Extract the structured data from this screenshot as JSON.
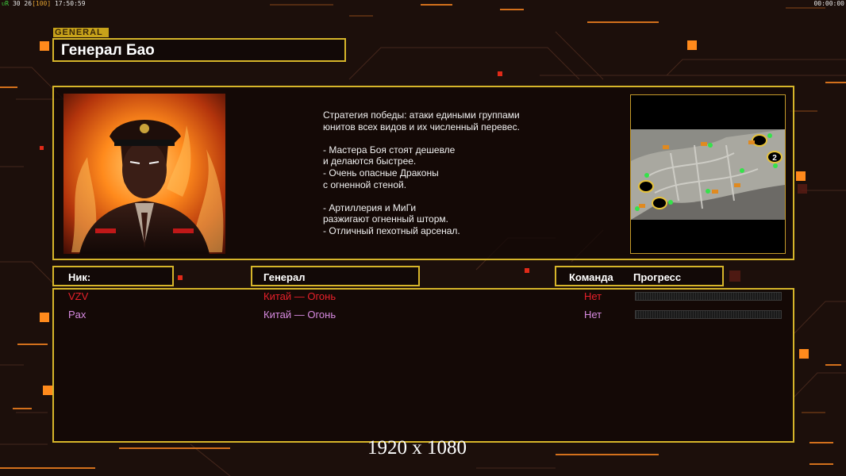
{
  "hud": {
    "top_left_prefix": "ᴜR",
    "top_left_fps": "30",
    "top_left_frame": "26",
    "top_left_bracket": "[100]",
    "top_left_time": "17:50:59",
    "top_right_time": "00:00:00"
  },
  "section_label": "GENERAL",
  "general_title": "Генерал Бао",
  "description": {
    "lines": [
      "Стратегия победы: атаки едиными группами",
      "юнитов всех видов и их численный перевес.",
      "",
      "- Мастера Боя стоят дешевле",
      "и делаются быстрее.",
      "- Очень опасные Драконы",
      "с огненной стеной.",
      "",
      "- Артиллерия и МиГи",
      "разжигают огненный шторм.",
      "- Отличный пехотный арсенал."
    ]
  },
  "map": {
    "marker_label": "2"
  },
  "table_headers": {
    "nick": "Ник:",
    "general": "Генерал",
    "team": "Команда",
    "progress": "Прогресс"
  },
  "players": [
    {
      "nick": "VZV",
      "general": "Китай — Огонь",
      "team": "Нет",
      "progress": 0,
      "color": "#e8202a"
    },
    {
      "nick": "Pax",
      "general": "Китай — Огонь",
      "team": "Нет",
      "progress": 0,
      "color": "#d78ae0"
    }
  ],
  "resolution_text": "1920 x 1080",
  "colors": {
    "frame": "#d6b52a",
    "accent_orange": "#ff8a1c",
    "background": "#1c0f0b"
  }
}
